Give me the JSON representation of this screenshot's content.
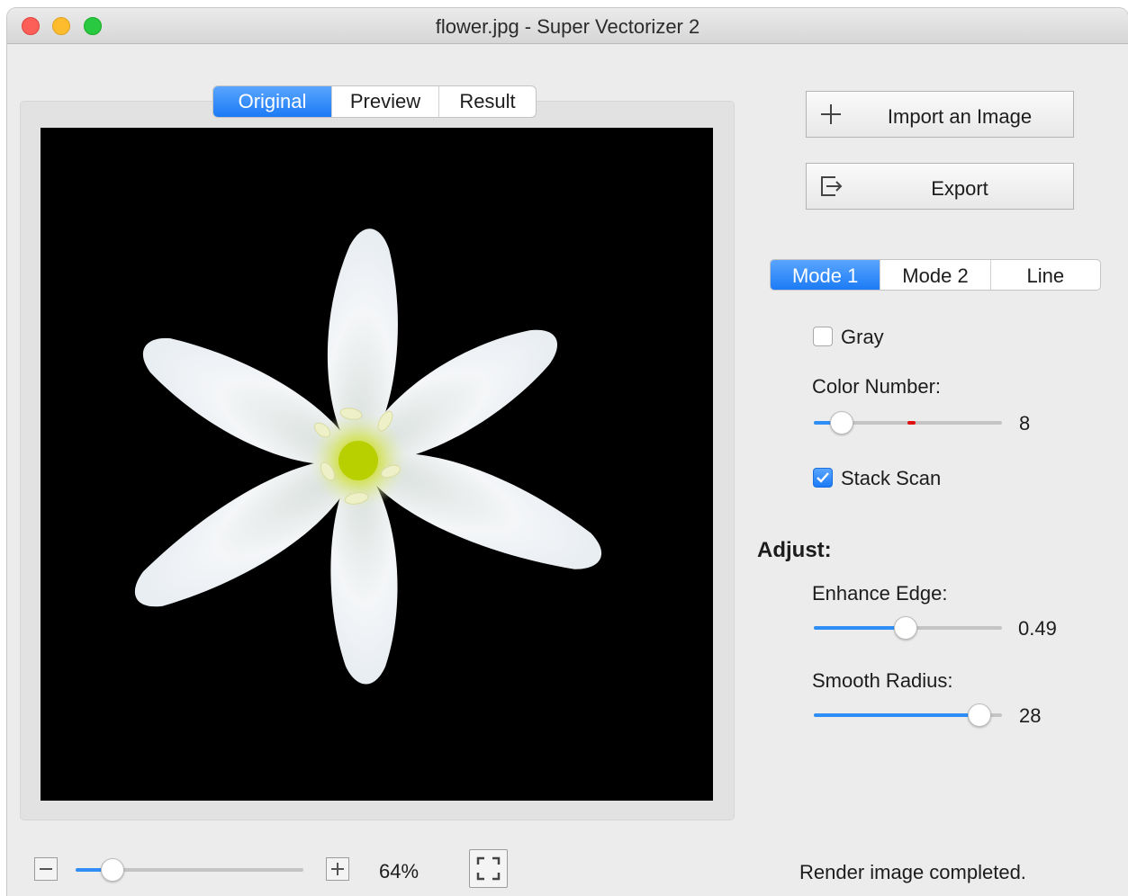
{
  "window": {
    "title": "flower.jpg - Super Vectorizer 2"
  },
  "view_tabs": [
    {
      "label": "Original",
      "active": true
    },
    {
      "label": "Preview",
      "active": false
    },
    {
      "label": "Result",
      "active": false
    }
  ],
  "canvas": {
    "image_desc": "white-flower-on-black"
  },
  "actions": {
    "import_label": "Import an Image",
    "export_label": "Export"
  },
  "modes": [
    {
      "label": "Mode 1",
      "active": true
    },
    {
      "label": "Mode 2",
      "active": false
    },
    {
      "label": "Line",
      "active": false
    }
  ],
  "options": {
    "gray_label": "Gray",
    "gray_checked": false,
    "color_number_label": "Color Number:",
    "color_number_value": "8",
    "color_number_fraction": 0.15,
    "stack_scan_label": "Stack Scan",
    "stack_scan_checked": true
  },
  "adjust": {
    "heading": "Adjust:",
    "enhance_edge_label": "Enhance Edge:",
    "enhance_edge_value": "0.49",
    "enhance_edge_fraction": 0.49,
    "smooth_radius_label": "Smooth Radius:",
    "smooth_radius_value": "28",
    "smooth_radius_fraction": 0.88
  },
  "zoom": {
    "value": "64%",
    "fraction": 0.16
  },
  "status": {
    "text": "Render image completed."
  },
  "colors": {
    "accent": "#1b7bf5",
    "slider_fill": "#2f8ef5",
    "marker": "#e01010"
  }
}
